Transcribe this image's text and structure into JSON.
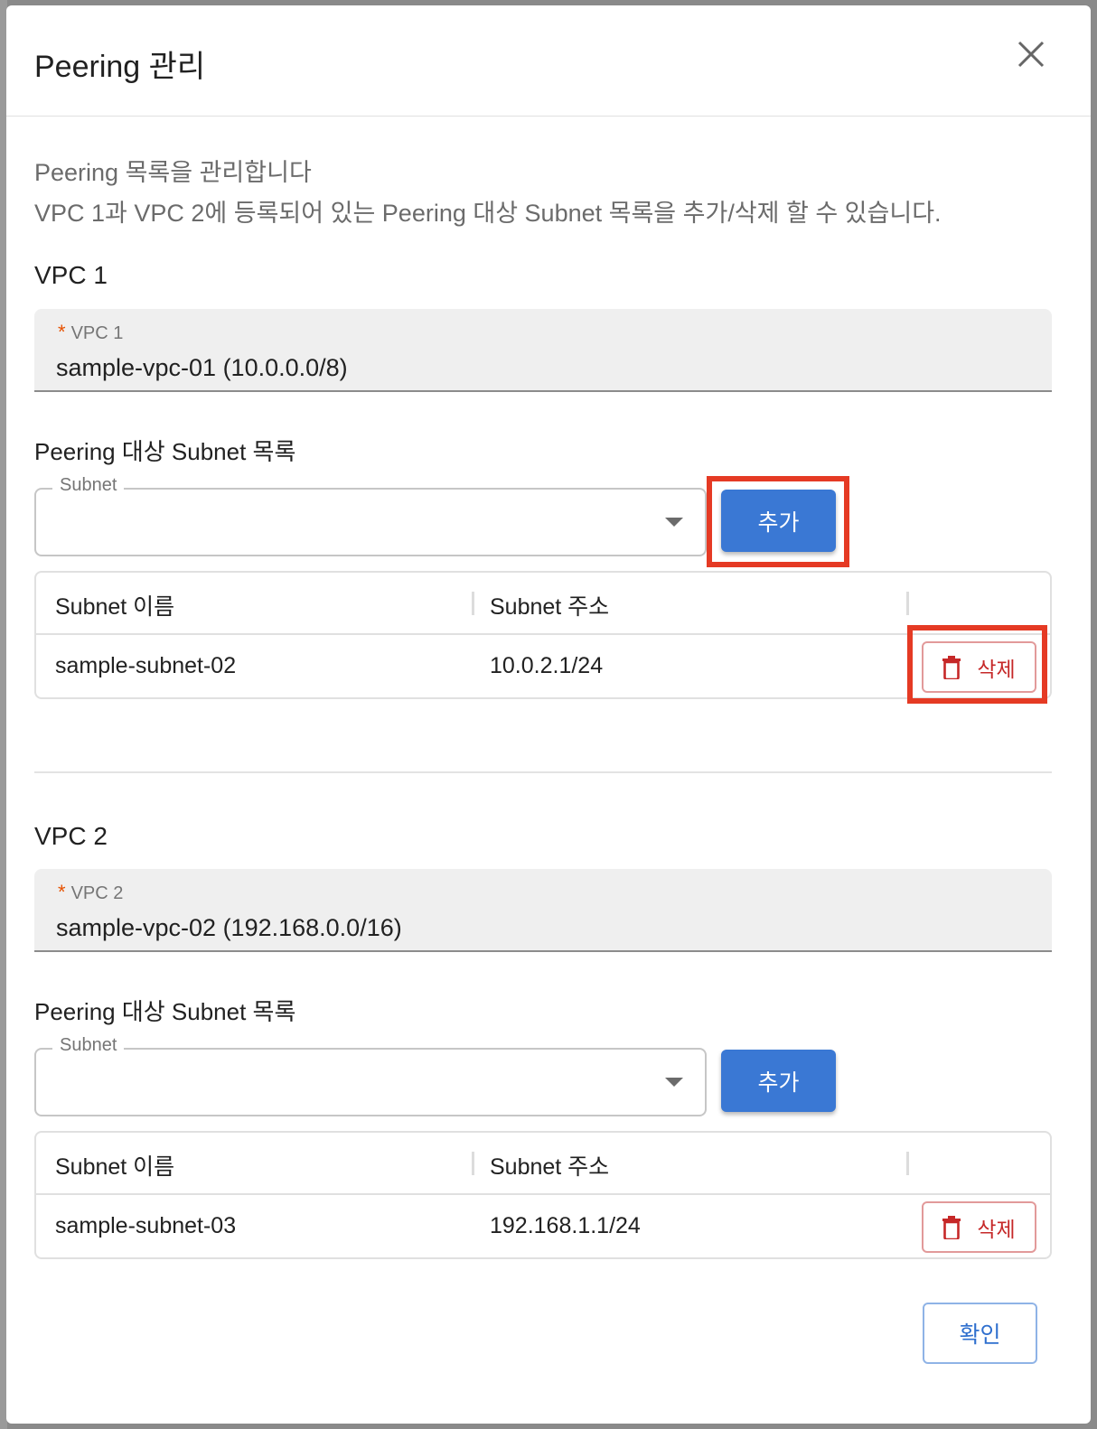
{
  "dialog": {
    "title": "Peering 관리",
    "close_icon": "close-icon",
    "description_line1": "Peering 목록을 관리합니다",
    "description_line2": "VPC 1과 VPC 2에 등록되어 있는 Peering 대상 Subnet 목록을 추가/삭제 할 수 있습니다.",
    "confirm_label": "확인"
  },
  "vpc1": {
    "section_title": "VPC 1",
    "field_label": "VPC 1",
    "required_mark": "*",
    "field_value": "sample-vpc-01 (10.0.0.0/8)",
    "subnet_list_title": "Peering 대상 Subnet 목록",
    "subnet_select_label": "Subnet",
    "subnet_select_value": "",
    "add_label": "추가",
    "table": {
      "columns": [
        "Subnet 이름",
        "Subnet 주소"
      ],
      "rows": [
        {
          "name": "sample-subnet-02",
          "address": "10.0.2.1/24",
          "delete_label": "삭제"
        }
      ]
    }
  },
  "vpc2": {
    "section_title": "VPC 2",
    "field_label": "VPC 2",
    "required_mark": "*",
    "field_value": "sample-vpc-02 (192.168.0.0/16)",
    "subnet_list_title": "Peering 대상 Subnet 목록",
    "subnet_select_label": "Subnet",
    "subnet_select_value": "",
    "add_label": "추가",
    "table": {
      "columns": [
        "Subnet 이름",
        "Subnet 주소"
      ],
      "rows": [
        {
          "name": "sample-subnet-03",
          "address": "192.168.1.1/24",
          "delete_label": "삭제"
        }
      ]
    }
  },
  "colors": {
    "primary": "#3a78d4",
    "danger": "#c62828",
    "highlight": "#e53a24",
    "required": "#e65100"
  },
  "icons": {
    "delete": "trash-icon",
    "select_arrow": "caret-down-icon"
  }
}
